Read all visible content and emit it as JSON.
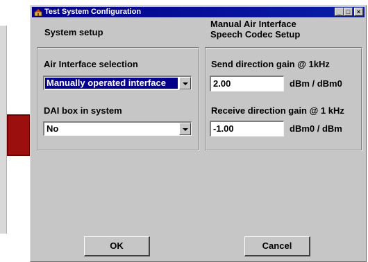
{
  "window": {
    "title": "Test System Configuration"
  },
  "titlebar": {
    "minimize": "_",
    "maximize": "□",
    "close": "×"
  },
  "left_panel": {
    "heading": "System setup",
    "air_interface_label": "Air Interface selection",
    "air_interface_value": "Manually operated interface",
    "dai_label": "DAI box in system",
    "dai_value": "No"
  },
  "right_panel": {
    "heading_line1": "Manual Air Interface",
    "heading_line2": "Speech Codec Setup",
    "send_label": "Send direction gain @ 1kHz",
    "send_value": "2.00",
    "send_unit": "dBm / dBm0",
    "receive_label": "Receive direction gain @ 1 kHz",
    "receive_value": "-1.00",
    "receive_unit": "dBm0 / dBm"
  },
  "buttons": {
    "ok": "OK",
    "cancel": "Cancel"
  },
  "colors": {
    "titlebar": "#04008a",
    "window": "#c6c6c6",
    "selection": "#04008a",
    "side_tab": "#9b0f0f"
  }
}
